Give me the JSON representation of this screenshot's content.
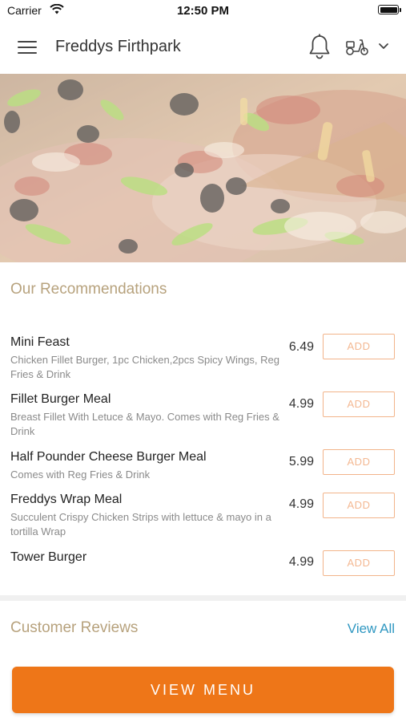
{
  "status_bar": {
    "carrier": "Carrier",
    "time": "12:50 PM"
  },
  "header": {
    "title": "Freddys Firthpark"
  },
  "recommendations": {
    "title": "Our Recommendations",
    "items": [
      {
        "name": "Mini Feast",
        "description": "Chicken Fillet Burger, 1pc Chicken,2pcs Spicy Wings, Reg Fries & Drink",
        "price": "6.49",
        "add_label": "ADD"
      },
      {
        "name": "Fillet Burger Meal",
        "description": "Breast Fillet With Letuce & Mayo. Comes with Reg Fries & Drink",
        "price": "4.99",
        "add_label": "ADD"
      },
      {
        "name": "Half Pounder Cheese Burger Meal",
        "description": "Comes with Reg Fries & Drink",
        "price": "5.99",
        "add_label": "ADD"
      },
      {
        "name": "Freddys Wrap Meal",
        "description": "Succulent Crispy Chicken Strips with lettuce & mayo in a tortilla Wrap",
        "price": "4.99",
        "add_label": "ADD"
      },
      {
        "name": "Tower Burger",
        "description": "",
        "price": "4.99",
        "add_label": "ADD"
      }
    ]
  },
  "reviews": {
    "title": "Customer Reviews",
    "view_all_label": "View All"
  },
  "footer": {
    "view_menu_label": "VIEW MENU"
  },
  "colors": {
    "accent_orange": "#ee7618",
    "section_title": "#b7a27d",
    "link_blue": "#2f97c1",
    "add_border": "#f2b48a"
  },
  "icons": {
    "menu": "hamburger-icon",
    "notifications": "bell-icon",
    "delivery": "scooter-icon",
    "dropdown": "chevron-down-icon"
  }
}
